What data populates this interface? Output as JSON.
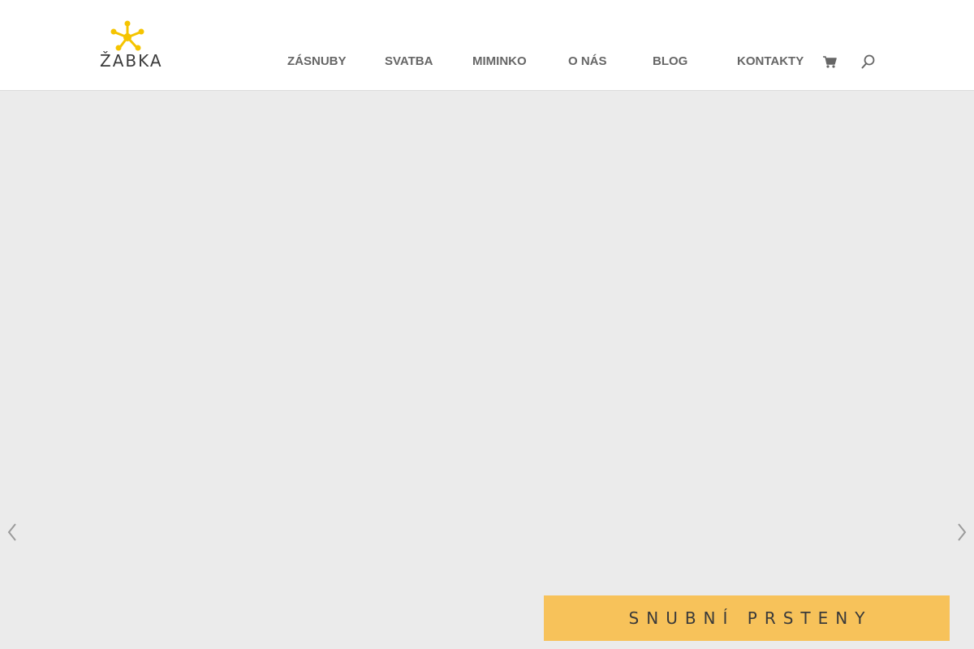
{
  "brand": {
    "logo_text": "ŽABKA",
    "logo_icon": "frog-foot-icon",
    "accent_color": "#f5c400"
  },
  "nav": {
    "items": [
      {
        "label": "ZÁSNUBY"
      },
      {
        "label": "SVATBA"
      },
      {
        "label": "MIMINKO"
      },
      {
        "label": "O NÁS"
      },
      {
        "label": "BLOG"
      },
      {
        "label": "KONTAKTY"
      }
    ],
    "cart_icon": "cart-icon",
    "search_icon": "search-icon"
  },
  "hero": {
    "prev_icon": "arrow-left-icon",
    "next_icon": "arrow-right-icon",
    "cta_label": "SNUBNÍ PRSTENY",
    "cta_color": "#f7c25a",
    "background_color": "#ebebeb"
  }
}
